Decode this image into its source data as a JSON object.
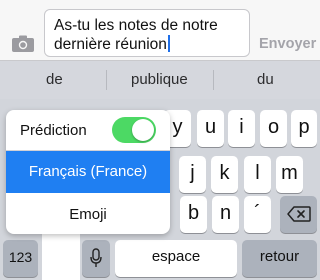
{
  "compose": {
    "line1": "As-tu les notes de notre",
    "line2": "dernière réunion",
    "send_label": "Envoyer"
  },
  "suggestions": [
    "de",
    "publique",
    "du"
  ],
  "keyboard": {
    "row1_visible": [
      "y",
      "u",
      "i",
      "o",
      "p"
    ],
    "row2_visible": [
      "j",
      "k",
      "l",
      "m"
    ],
    "row3_visible": [
      "b",
      "n",
      "´"
    ],
    "numbers_label": "123",
    "space_label": "espace",
    "return_label": "retour"
  },
  "popover": {
    "prediction_label": "Prédiction",
    "prediction_on": true,
    "selected_language": "Français (France)",
    "emoji_label": "Emoji"
  },
  "colors": {
    "accent": "#1f7ff2",
    "toggle_on": "#4cd964"
  }
}
